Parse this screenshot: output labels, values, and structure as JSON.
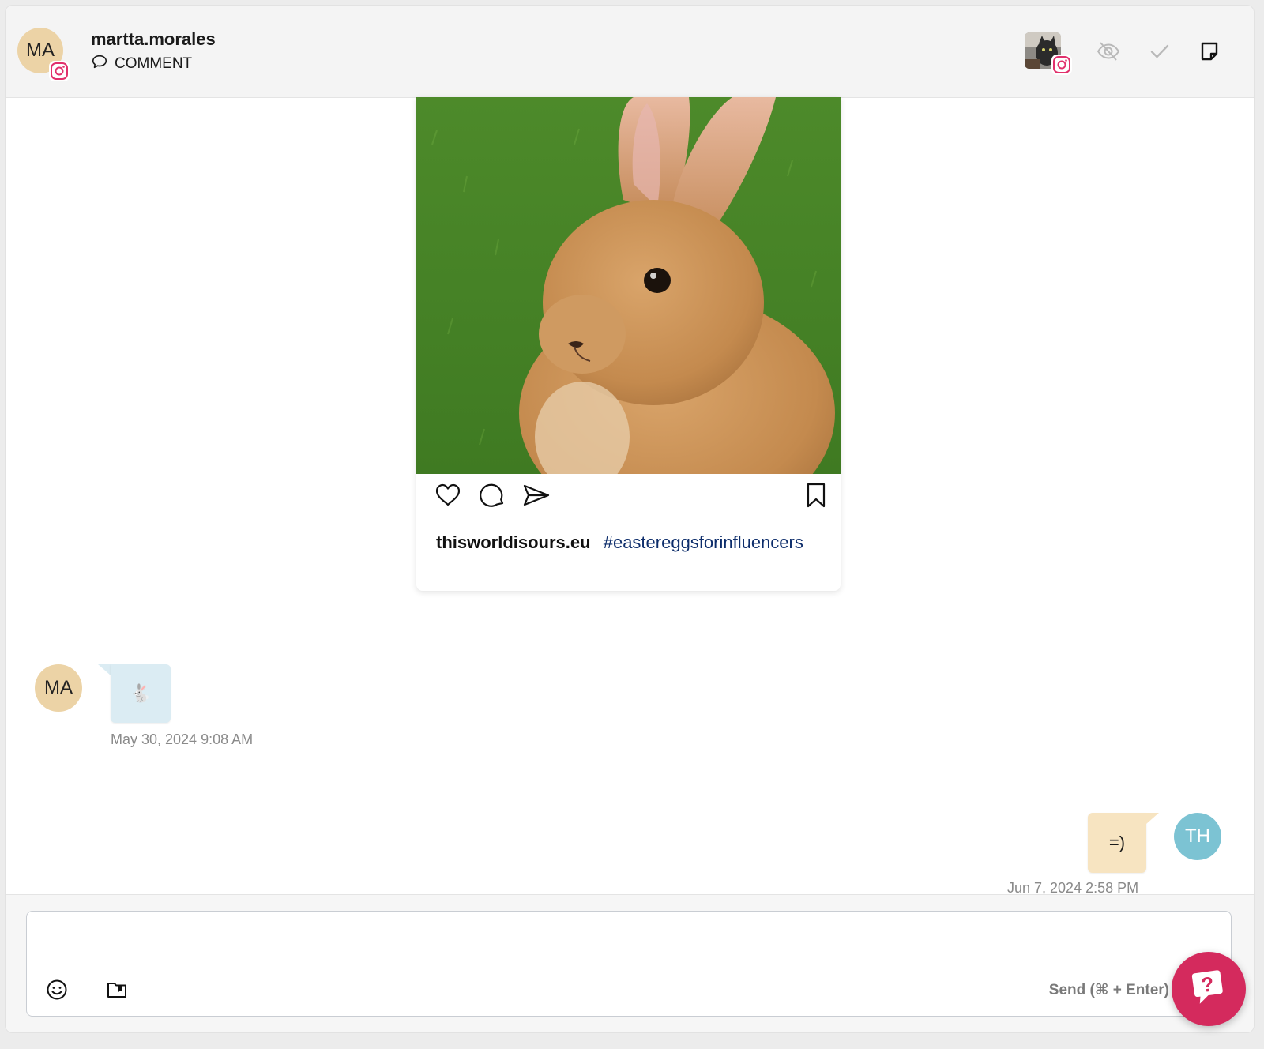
{
  "header": {
    "avatar_initials": "MA",
    "username": "martta.morales",
    "type_label": "COMMENT",
    "network_icon": "instagram-icon",
    "actions": [
      "hide-icon",
      "check-icon",
      "note-icon"
    ]
  },
  "post": {
    "image": "rabbit-photo",
    "actions": [
      "heart-icon",
      "comment-icon",
      "share-icon",
      "bookmark-icon"
    ],
    "caption_user": "thisworldisours.eu",
    "caption_tag": "#eastereggsforinfluencers"
  },
  "messages": [
    {
      "direction": "incoming",
      "avatar": "MA",
      "text": "🐇",
      "timestamp": "May 30, 2024 9:08 AM"
    },
    {
      "direction": "outgoing",
      "avatar": "TH",
      "text": "=)",
      "timestamp": "Jun 7, 2024 2:58 PM"
    }
  ],
  "composer": {
    "value": "",
    "send_label": "Send (⌘ + Enter)",
    "icons": [
      "emoji-icon",
      "saved-replies-icon"
    ]
  },
  "colors": {
    "instagram": "#e1306c",
    "avatar_ma": "#ecd3a6",
    "avatar_th": "#7cc3d3",
    "bubble_in": "#dbecf3",
    "bubble_out": "#f7e4c1",
    "help_fab": "#d42a5d",
    "hashtag": "#0d2d6b"
  }
}
